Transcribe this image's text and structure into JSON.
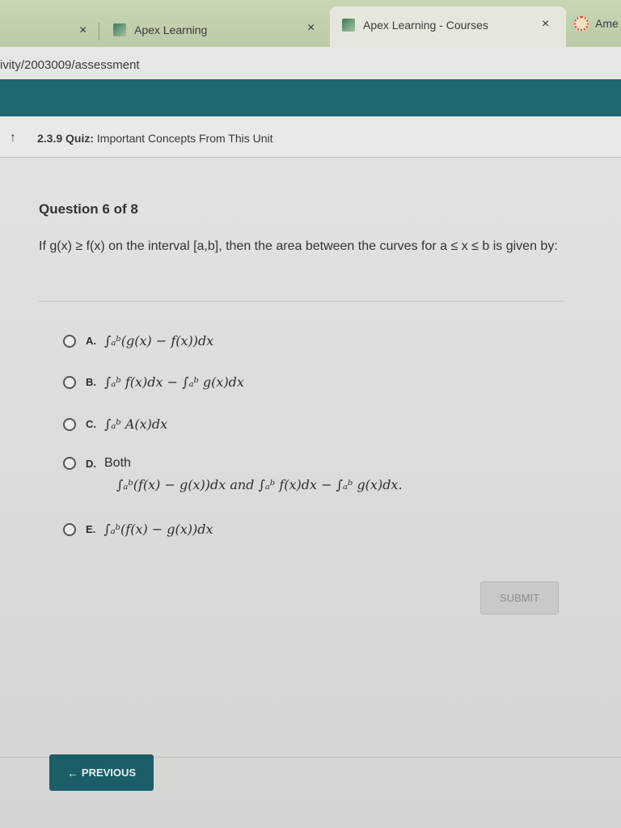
{
  "browser": {
    "tabs": [
      {
        "label": "Apex Learning",
        "close": "×"
      },
      {
        "label": "Apex Learning - Courses",
        "close": "×"
      },
      {
        "label": "Ame"
      }
    ],
    "first_close": "×",
    "url": "ivity/2003009/assessment"
  },
  "header": {
    "back_icon": "up-arrow-icon",
    "quiz_number": "2.3.9",
    "quiz_label": "Quiz:",
    "quiz_name": "Important Concepts From This Unit"
  },
  "question": {
    "number": "Question 6 of 8",
    "text": "If g(x) ≥ f(x) on the interval [a,b], then the area between the curves for a ≤ x ≤ b is given by:"
  },
  "options": [
    {
      "letter": "A.",
      "text": "∫ₐᵇ(g(x) − f(x))dx"
    },
    {
      "letter": "B.",
      "text": "∫ₐᵇ f(x)dx − ∫ₐᵇ g(x)dx"
    },
    {
      "letter": "C.",
      "text": "∫ₐᵇ A(x)dx"
    },
    {
      "letter": "D.",
      "text": "Both",
      "text2": "∫ₐᵇ(f(x) − g(x))dx and ∫ₐᵇ f(x)dx − ∫ₐᵇ g(x)dx."
    },
    {
      "letter": "E.",
      "text": "∫ₐᵇ(f(x) − g(x))dx"
    }
  ],
  "buttons": {
    "submit": "SUBMIT",
    "previous": "PREVIOUS",
    "previous_icon": "←"
  }
}
